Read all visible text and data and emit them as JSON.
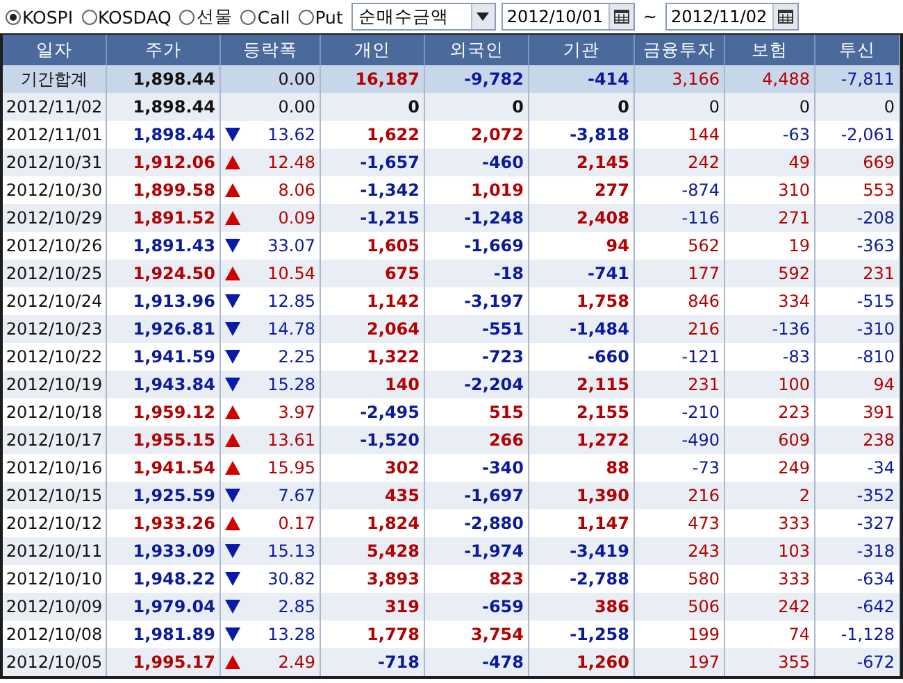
{
  "toolbar": {
    "radios": [
      {
        "label": "KOSPI",
        "selected": true
      },
      {
        "label": "KOSDAQ",
        "selected": false
      },
      {
        "label": "선물",
        "selected": false
      },
      {
        "label": "Call",
        "selected": false
      },
      {
        "label": "Put",
        "selected": false
      }
    ],
    "dropdown": {
      "value": "순매수금액"
    },
    "date_from": {
      "value": "2012/10/01"
    },
    "separator": "~",
    "date_to": {
      "value": "2012/11/02"
    }
  },
  "table": {
    "columns": [
      "일자",
      "주가",
      "등락폭",
      "개인",
      "외국인",
      "기관",
      "금융투자",
      "보험",
      "투신"
    ],
    "rows": [
      {
        "kind": "summary",
        "date": "기간합계",
        "price": "1,898.44",
        "up": false,
        "down": false,
        "change": "0.00",
        "values": [
          "16,187",
          "-9,782",
          "-414",
          "3,166",
          "4,488",
          "-7,811"
        ]
      },
      {
        "kind": "day",
        "date": "2012/11/02",
        "price": "1,898.44",
        "up": false,
        "down": false,
        "change": "0.00",
        "values": [
          "0",
          "0",
          "0",
          "0",
          "0",
          "0"
        ]
      },
      {
        "kind": "day",
        "date": "2012/11/01",
        "price": "1,898.44",
        "up": false,
        "down": true,
        "change": "13.62",
        "values": [
          "1,622",
          "2,072",
          "-3,818",
          "144",
          "-63",
          "-2,061"
        ]
      },
      {
        "kind": "day",
        "date": "2012/10/31",
        "price": "1,912.06",
        "up": true,
        "down": false,
        "change": "12.48",
        "values": [
          "-1,657",
          "-460",
          "2,145",
          "242",
          "49",
          "669"
        ]
      },
      {
        "kind": "day",
        "date": "2012/10/30",
        "price": "1,899.58",
        "up": true,
        "down": false,
        "change": "8.06",
        "values": [
          "-1,342",
          "1,019",
          "277",
          "-874",
          "310",
          "553"
        ]
      },
      {
        "kind": "day",
        "date": "2012/10/29",
        "price": "1,891.52",
        "up": true,
        "down": false,
        "change": "0.09",
        "values": [
          "-1,215",
          "-1,248",
          "2,408",
          "-116",
          "271",
          "-208"
        ]
      },
      {
        "kind": "day",
        "date": "2012/10/26",
        "price": "1,891.43",
        "up": false,
        "down": true,
        "change": "33.07",
        "values": [
          "1,605",
          "-1,669",
          "94",
          "562",
          "19",
          "-363"
        ]
      },
      {
        "kind": "day",
        "date": "2012/10/25",
        "price": "1,924.50",
        "up": true,
        "down": false,
        "change": "10.54",
        "values": [
          "675",
          "-18",
          "-741",
          "177",
          "592",
          "231"
        ]
      },
      {
        "kind": "day",
        "date": "2012/10/24",
        "price": "1,913.96",
        "up": false,
        "down": true,
        "change": "12.85",
        "values": [
          "1,142",
          "-3,197",
          "1,758",
          "846",
          "334",
          "-515"
        ]
      },
      {
        "kind": "day",
        "date": "2012/10/23",
        "price": "1,926.81",
        "up": false,
        "down": true,
        "change": "14.78",
        "values": [
          "2,064",
          "-551",
          "-1,484",
          "216",
          "-136",
          "-310"
        ]
      },
      {
        "kind": "day",
        "date": "2012/10/22",
        "price": "1,941.59",
        "up": false,
        "down": true,
        "change": "2.25",
        "values": [
          "1,322",
          "-723",
          "-660",
          "-121",
          "-83",
          "-810"
        ]
      },
      {
        "kind": "day",
        "date": "2012/10/19",
        "price": "1,943.84",
        "up": false,
        "down": true,
        "change": "15.28",
        "values": [
          "140",
          "-2,204",
          "2,115",
          "231",
          "100",
          "94"
        ]
      },
      {
        "kind": "day",
        "date": "2012/10/18",
        "price": "1,959.12",
        "up": true,
        "down": false,
        "change": "3.97",
        "values": [
          "-2,495",
          "515",
          "2,155",
          "-210",
          "223",
          "391"
        ]
      },
      {
        "kind": "day",
        "date": "2012/10/17",
        "price": "1,955.15",
        "up": true,
        "down": false,
        "change": "13.61",
        "values": [
          "-1,520",
          "266",
          "1,272",
          "-490",
          "609",
          "238"
        ]
      },
      {
        "kind": "day",
        "date": "2012/10/16",
        "price": "1,941.54",
        "up": true,
        "down": false,
        "change": "15.95",
        "values": [
          "302",
          "-340",
          "88",
          "-73",
          "249",
          "-34"
        ]
      },
      {
        "kind": "day",
        "date": "2012/10/15",
        "price": "1,925.59",
        "up": false,
        "down": true,
        "change": "7.67",
        "values": [
          "435",
          "-1,697",
          "1,390",
          "216",
          "2",
          "-352"
        ]
      },
      {
        "kind": "day",
        "date": "2012/10/12",
        "price": "1,933.26",
        "up": true,
        "down": false,
        "change": "0.17",
        "values": [
          "1,824",
          "-2,880",
          "1,147",
          "473",
          "333",
          "-327"
        ]
      },
      {
        "kind": "day",
        "date": "2012/10/11",
        "price": "1,933.09",
        "up": false,
        "down": true,
        "change": "15.13",
        "values": [
          "5,428",
          "-1,974",
          "-3,419",
          "243",
          "103",
          "-318"
        ]
      },
      {
        "kind": "day",
        "date": "2012/10/10",
        "price": "1,948.22",
        "up": false,
        "down": true,
        "change": "30.82",
        "values": [
          "3,893",
          "823",
          "-2,788",
          "580",
          "333",
          "-634"
        ]
      },
      {
        "kind": "day",
        "date": "2012/10/09",
        "price": "1,979.04",
        "up": false,
        "down": true,
        "change": "2.85",
        "values": [
          "319",
          "-659",
          "386",
          "506",
          "242",
          "-642"
        ]
      },
      {
        "kind": "day",
        "date": "2012/10/08",
        "price": "1,981.89",
        "up": false,
        "down": true,
        "change": "13.28",
        "values": [
          "1,778",
          "3,754",
          "-1,258",
          "199",
          "74",
          "-1,128"
        ]
      },
      {
        "kind": "day",
        "date": "2012/10/05",
        "price": "1,995.17",
        "up": true,
        "down": false,
        "change": "2.49",
        "values": [
          "-718",
          "-478",
          "1,260",
          "197",
          "355",
          "-672"
        ]
      }
    ]
  }
}
